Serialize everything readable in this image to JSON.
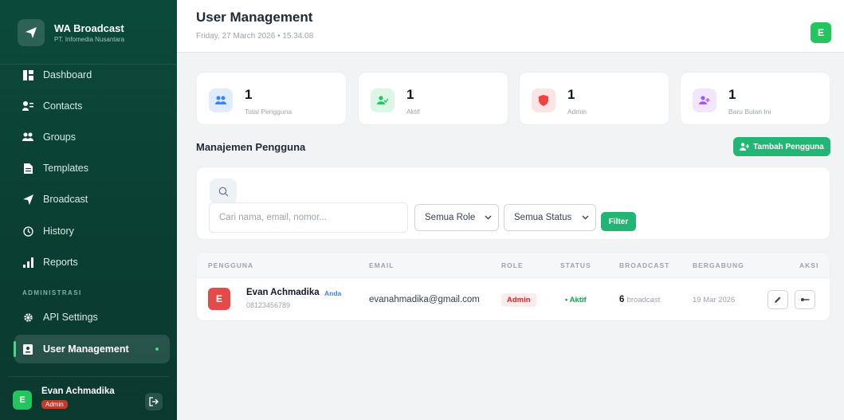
{
  "brand": {
    "title": "WA Broadcast",
    "subtitle": "PT. Infomedia Nusantara"
  },
  "nav": {
    "items": [
      {
        "label": "Dashboard",
        "icon": "dashboard-icon"
      },
      {
        "label": "Contacts",
        "icon": "contacts-icon"
      },
      {
        "label": "Groups",
        "icon": "groups-icon"
      },
      {
        "label": "Templates",
        "icon": "templates-icon"
      },
      {
        "label": "Broadcast",
        "icon": "send-icon"
      },
      {
        "label": "History",
        "icon": "history-icon"
      },
      {
        "label": "Reports",
        "icon": "reports-icon"
      }
    ],
    "section_label": "ADMINISTRASI",
    "admin_items": [
      {
        "label": "API Settings",
        "icon": "gear-icon"
      },
      {
        "label": "User Management",
        "icon": "user-card-icon",
        "active": true
      }
    ]
  },
  "sidebar_user": {
    "initial": "E",
    "name": "Evan Achmadika",
    "role": "Admin"
  },
  "header": {
    "title": "User Management",
    "date": "Friday, 27 March 2026 • 15.34.08",
    "avatar_initial": "E"
  },
  "stats": [
    {
      "value": "1",
      "label": "Total Pengguna",
      "color": "#3b82f6"
    },
    {
      "value": "1",
      "label": "Aktif",
      "color": "#22c55e"
    },
    {
      "value": "1",
      "label": "Admin",
      "color": "#ef4444"
    },
    {
      "value": "1",
      "label": "Baru Bulan Ini",
      "color": "#a855f7"
    }
  ],
  "section": {
    "title": "Manajemen Pengguna",
    "add_button": "Tambah Pengguna"
  },
  "filter": {
    "search_placeholder": "Cari nama, email, nomor...",
    "role_select": "Semua Role",
    "status_select": "Semua Status",
    "filter_button": "Filter"
  },
  "table": {
    "headers": [
      "PENGGUNA",
      "EMAIL",
      "ROLE",
      "STATUS",
      "BROADCAST",
      "BERGABUNG",
      "AKSI"
    ],
    "rows": [
      {
        "initial": "E",
        "name": "Evan Achmadika",
        "tag": "Anda",
        "phone": "08123456789",
        "email": "evanahmadika@gmail.com",
        "role": "Admin",
        "status": "• Aktif",
        "broadcast_count": "6",
        "broadcast_label": "broadcast",
        "joined": "19 Mar 2026"
      }
    ]
  }
}
